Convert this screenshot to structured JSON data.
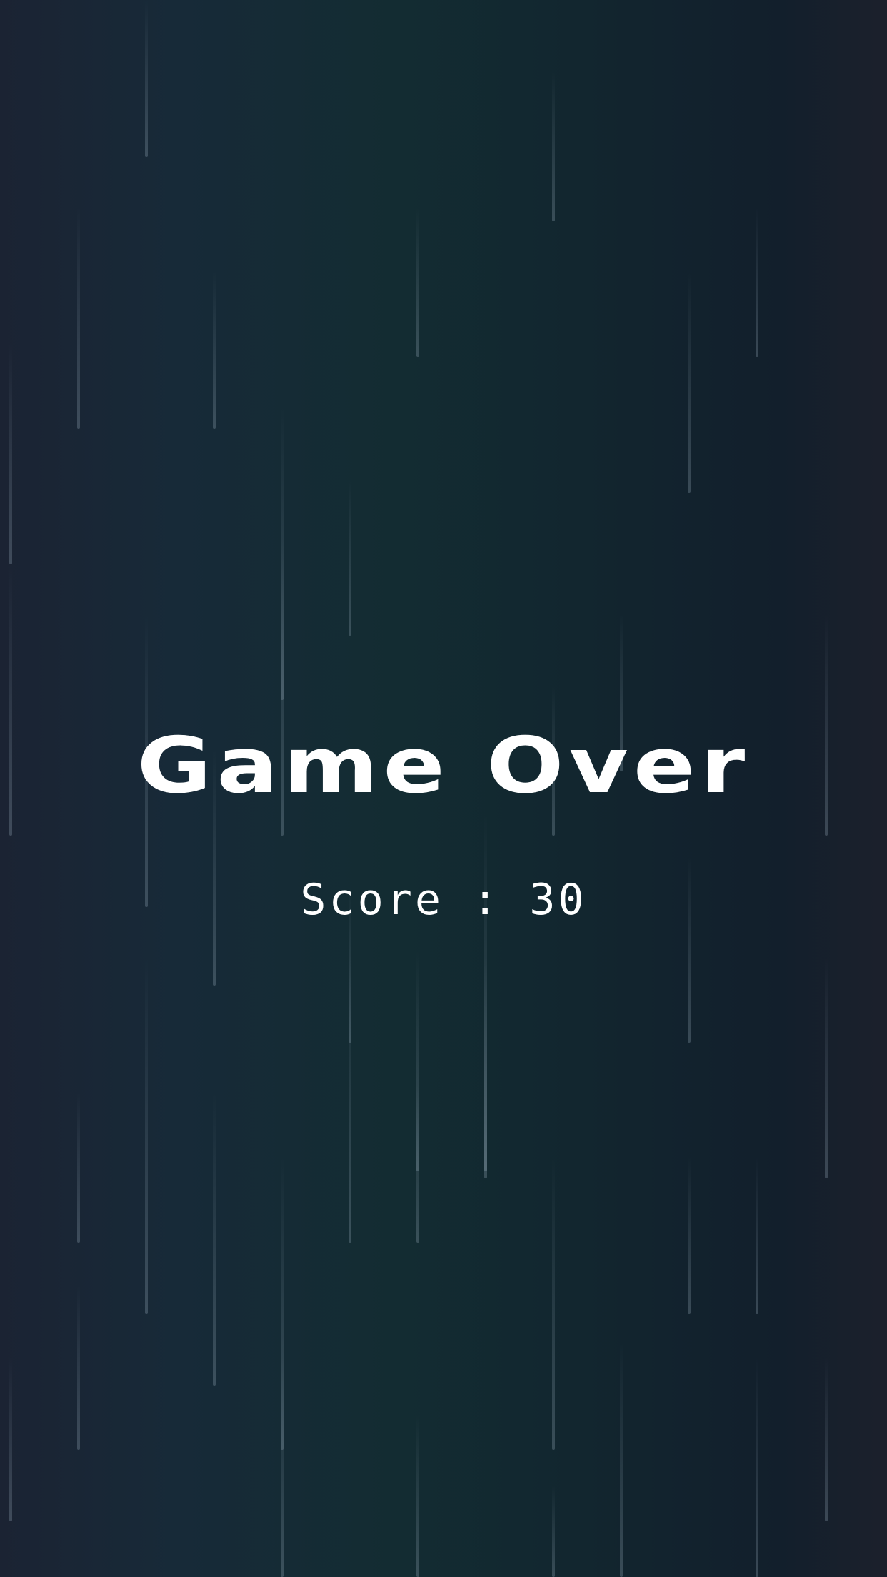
{
  "screen": "game-over",
  "title": "Game Over",
  "score_text": "Score : 30",
  "colors": {
    "text": "#ffffff",
    "background_dark": "#1b2333",
    "background_teal": "#132c32",
    "rain": "#9fb3c2"
  }
}
